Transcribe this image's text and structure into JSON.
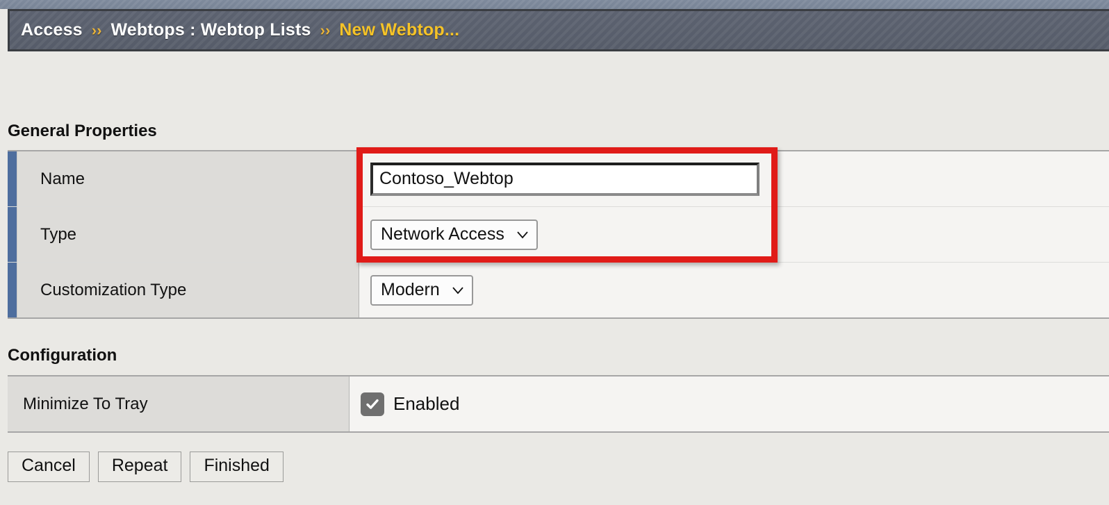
{
  "header": {
    "crumbs": [
      {
        "label": "Access",
        "current": false
      },
      {
        "label": "Webtops : Webtop Lists",
        "current": false
      },
      {
        "label": "New Webtop...",
        "current": true
      }
    ],
    "separator": "››",
    "bar_color": "#565c69",
    "current_color": "#f5c328"
  },
  "sections": {
    "general": {
      "title": "General Properties",
      "rows": [
        {
          "label": "Name",
          "control": "text",
          "value": "Contoso_Webtop",
          "placeholder": ""
        },
        {
          "label": "Type",
          "control": "select",
          "value": "Network Access"
        },
        {
          "label": "Customization Type",
          "control": "select",
          "value": "Modern"
        }
      ]
    },
    "configuration": {
      "title": "Configuration",
      "rows": [
        {
          "label": "Minimize To Tray",
          "control": "checkbox",
          "checked": true,
          "checkbox_label": "Enabled"
        }
      ]
    }
  },
  "annotation": {
    "color": "#e01b18"
  },
  "buttons": [
    {
      "label": "Cancel"
    },
    {
      "label": "Repeat"
    },
    {
      "label": "Finished"
    }
  ],
  "icons": {
    "chevron_down": "chevron-down-icon",
    "checkmark": "checkmark-icon"
  }
}
